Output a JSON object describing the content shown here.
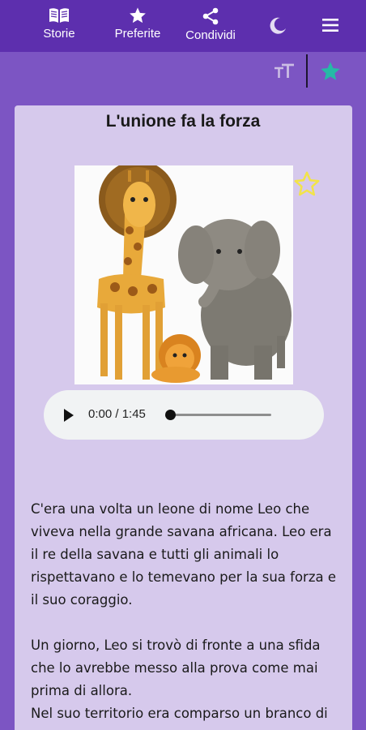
{
  "nav": {
    "storie": {
      "label": "Storie",
      "icon": "book-icon"
    },
    "preferite": {
      "label": "Preferite",
      "icon": "star-icon"
    },
    "condividi": {
      "label": "Condividi",
      "icon": "share-icon"
    },
    "theme": {
      "icon": "moon-icon"
    },
    "menu": {
      "icon": "menu-icon"
    }
  },
  "toolbar": {
    "font_size_icon": "text-size-icon",
    "favorite_icon": "star-filled-icon",
    "favorite_color": "#26b9a6"
  },
  "story": {
    "title": "L'unione fa la forza",
    "favorite_icon": "star-outline-icon",
    "favorite_color": "#f2e34a",
    "paragraphs": [
      "C'era una volta un leone di nome Leo che viveva nella grande savana africana. Leo era il re della savana e tutti gli animali lo rispettavano e lo temevano per la sua forza e il suo coraggio.",
      "Un giorno, Leo si trovò di fronte a una sfida che lo avrebbe messo alla prova come mai prima di allora.",
      "Nel suo territorio era comparso un branco di"
    ]
  },
  "audio": {
    "time": "0:00 / 1:45",
    "progress": 0
  },
  "colors": {
    "topbar": "#5d2fae",
    "background": "#7c55c3",
    "card": "#d6c9ec"
  }
}
